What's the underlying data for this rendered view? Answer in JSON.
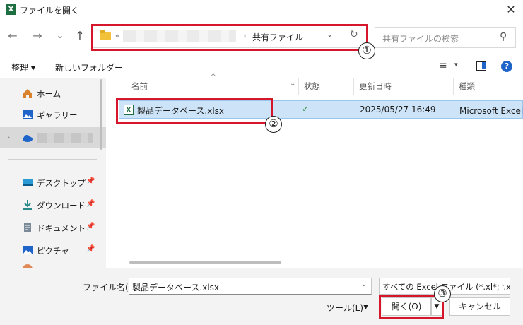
{
  "window": {
    "title": "ファイルを開く",
    "app_icon": "X",
    "close": "✕"
  },
  "nav": {
    "back": "←",
    "forward": "→",
    "recent": "⌄",
    "up": "↑"
  },
  "address": {
    "overflow": "«",
    "separator": "›",
    "current": "共有ファイル"
  },
  "search": {
    "placeholder": "共有ファイルの検索"
  },
  "toolbar": {
    "organize": "整理 ▾",
    "new_folder": "新しいフォルダー",
    "view_icon": "≡",
    "view_dropdown": "▾",
    "help": "?"
  },
  "sidebar": {
    "items": [
      {
        "label": "ホーム",
        "icon": "home-icon"
      },
      {
        "label": "ギャラリー",
        "icon": "gallery-icon"
      },
      {
        "label": "",
        "icon": "onedrive-icon"
      },
      {
        "label": "デスクトップ",
        "icon": "desktop-icon",
        "pin": "📌"
      },
      {
        "label": "ダウンロード",
        "icon": "download-icon",
        "pin": "📌"
      },
      {
        "label": "ドキュメント",
        "icon": "document-icon",
        "pin": "📌"
      },
      {
        "label": "ピクチャ",
        "icon": "pictures-icon",
        "pin": "📌"
      }
    ]
  },
  "columns": {
    "name": "名前",
    "status": "状態",
    "modified": "更新日時",
    "type": "種類"
  },
  "files": [
    {
      "name": "製品データベース.xlsx",
      "status": "✓",
      "modified": "2025/05/27 16:49",
      "type": "Microsoft Excel ワ"
    }
  ],
  "bottom": {
    "filename_label": "ファイル名(N):",
    "filename_value": "製品データベース.xlsx",
    "filter_value": "すべての Excel ファイル (*.xl*;*.xlsx;*",
    "tools": "ツール(L)",
    "open": "開く(O)",
    "cancel": "キャンセル"
  },
  "annotations": {
    "one": "①",
    "two": "②",
    "three": "③"
  },
  "colors": {
    "accent": "#1f64c8",
    "highlight": "#d6172b",
    "selection": "#cde3f7"
  }
}
